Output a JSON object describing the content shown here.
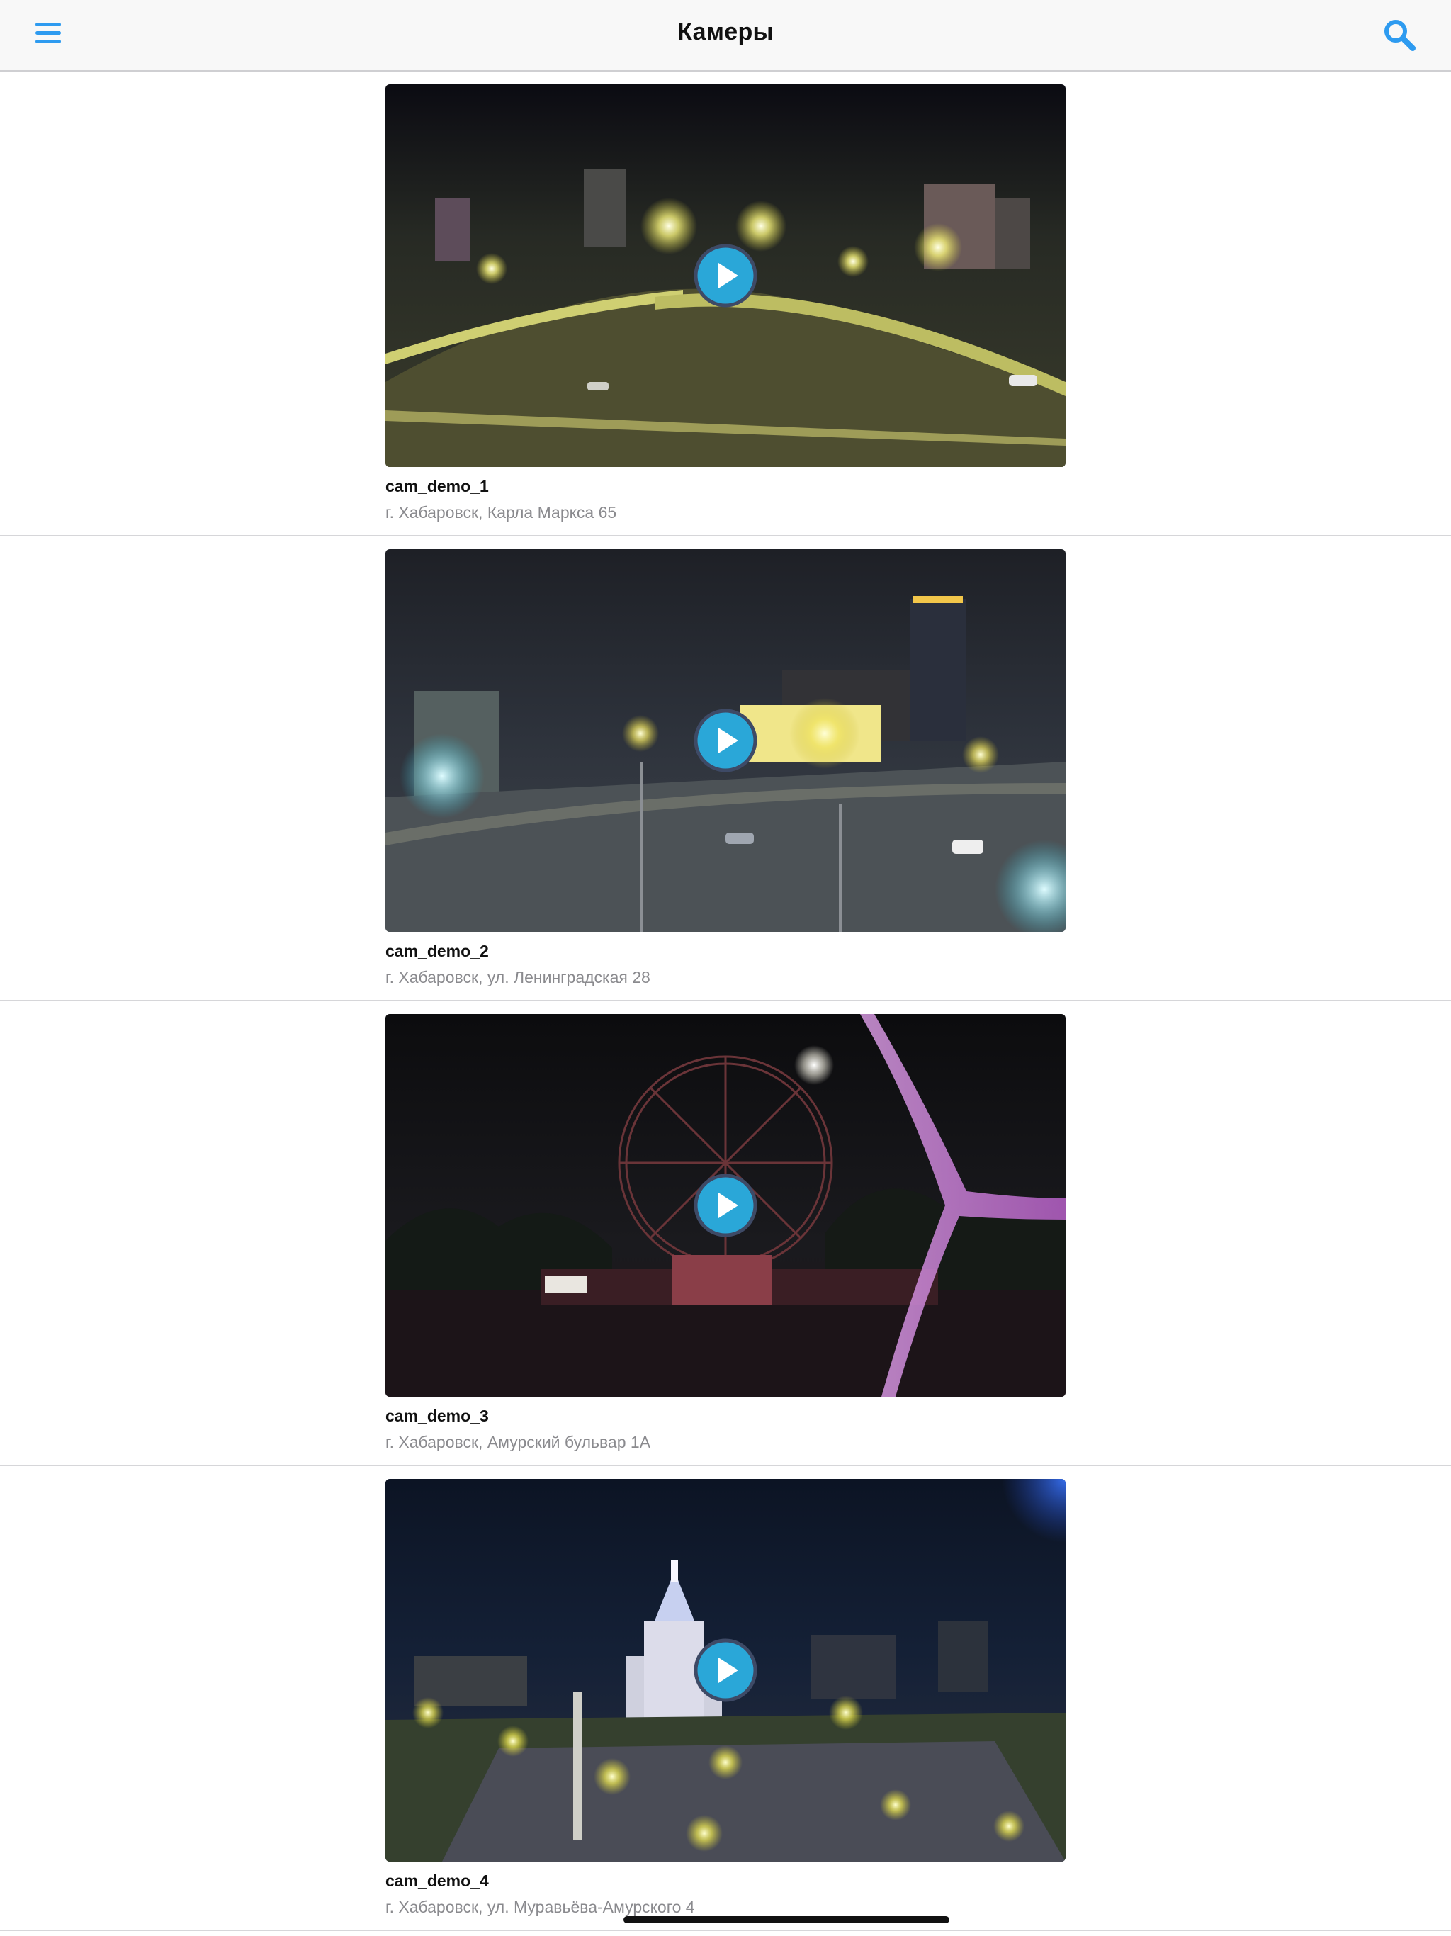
{
  "navbar": {
    "title": "Камеры",
    "menu_icon": "hamburger-menu-icon",
    "search_icon": "search-icon",
    "accent_color": "#2e9bf0"
  },
  "cameras": [
    {
      "name": "cam_demo_1",
      "address": "г. Хабаровск, Карла Маркса 65",
      "scene": "night-overpass",
      "play_icon": "play-icon"
    },
    {
      "name": "cam_demo_2",
      "address": "г. Хабаровск, ул. Ленинградская 28",
      "scene": "night-intersection",
      "play_icon": "play-icon"
    },
    {
      "name": "cam_demo_3",
      "address": "г. Хабаровск, Амурский бульвар 1А",
      "scene": "night-ferris-wheel",
      "play_icon": "play-icon"
    },
    {
      "name": "cam_demo_4",
      "address": "г. Хабаровск, ул. Муравьёва-Амурского 4",
      "scene": "night-cathedral-square",
      "play_icon": "play-icon"
    }
  ],
  "colors": {
    "play_button": "#2aa7d8",
    "name_text": "#111111",
    "address_text": "#8a8a8e"
  }
}
